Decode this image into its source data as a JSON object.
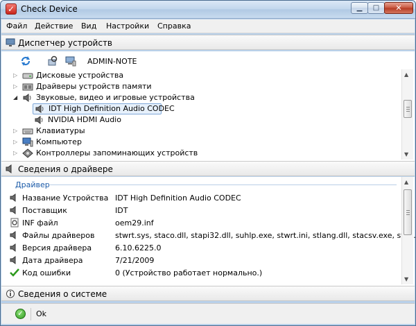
{
  "window": {
    "title": "Check Device"
  },
  "menu": [
    "Файл",
    "Действие",
    "Вид",
    "Настройки",
    "Справка"
  ],
  "device_manager": {
    "header": "Диспетчер устройств",
    "machine_name": "ADMIN-NOTE",
    "tree": [
      {
        "label": "Дисковые устройства",
        "expanded": false
      },
      {
        "label": "Драйверы устройств памяти",
        "expanded": false
      },
      {
        "label": "Звуковые, видео и игровые устройства",
        "expanded": true
      },
      {
        "label": "IDT High Definition Audio CODEC",
        "child": true,
        "selected": true
      },
      {
        "label": "NVIDIA HDMI Audio",
        "child": true
      },
      {
        "label": "Клавиатуры",
        "expanded": false
      },
      {
        "label": "Компьютер",
        "expanded": false
      },
      {
        "label": "Контроллеры запоминающих устройств",
        "expanded": false
      }
    ]
  },
  "driver_info": {
    "header": "Сведения о драйвере",
    "group_title": "Драйвер",
    "properties": [
      {
        "label": "Название Устройства",
        "value": "IDT High Definition Audio CODEC",
        "icon": "speaker-icon"
      },
      {
        "label": "Поставщик",
        "value": "IDT",
        "icon": "speaker-icon"
      },
      {
        "label": "INF файл",
        "value": "oem29.inf",
        "icon": "gear-file-icon"
      },
      {
        "label": "Файлы драйверов",
        "value": "stwrt.sys, staco.dll, stapi32.dll, suhlp.exe, stwrt.ini, stlang.dll, stacsv.exe, stap...",
        "icon": "speaker-icon"
      },
      {
        "label": "Версия драйвера",
        "value": "6.10.6225.0",
        "icon": "speaker-icon"
      },
      {
        "label": "Дата драйвера",
        "value": "7/21/2009",
        "icon": "speaker-icon"
      },
      {
        "label": "Код ошибки",
        "value": "0 (Устройство работает нормально.)",
        "icon": "checkmark-icon"
      }
    ]
  },
  "system_info": {
    "header": "Сведения о системе"
  },
  "status": {
    "text": "Ok"
  },
  "colors": {
    "accent": "#1a5aa8",
    "selection": "#e6f0fb"
  }
}
